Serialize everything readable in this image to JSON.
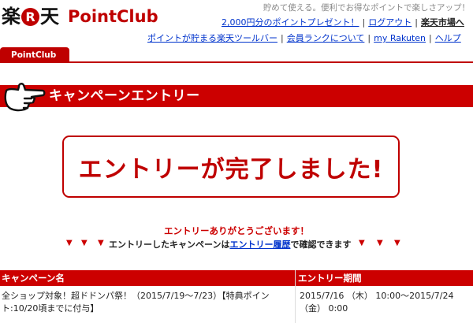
{
  "header": {
    "logo_raku": "楽",
    "logo_r": "R",
    "logo_ten": "天",
    "logo_pointclub": "PointClub",
    "tagline": "貯めて使える。便利でお得なポイントで楽しさアップ！",
    "links_row1": [
      "2,000円分のポイントプレゼント！",
      "ログアウト",
      "楽天市場へ"
    ],
    "links_row2": [
      "ポイントが貯まる楽天ツールバー",
      "会員ランクについて",
      "my Rakuten",
      "ヘルプ"
    ]
  },
  "tab": {
    "label": "PointClub"
  },
  "banner": {
    "title": "キャンペーンエントリー",
    "icon": "pointing-hand-icon"
  },
  "complete": {
    "message": "エントリーが完了しました!"
  },
  "thanks": {
    "message": "エントリーありがとうございます！",
    "confirm_before": "エントリーしたキャンペーンは",
    "confirm_link": "エントリー履歴",
    "confirm_after": "で確認できます",
    "marker": "▼"
  },
  "table": {
    "headers": [
      "キャンペーン名",
      "エントリー期間"
    ],
    "rows": [
      {
        "campaign": "全ショップ対象！超ドドンパ祭！（2015/7/19〜7/23）【特典ポイント:10/20頃までに付与】",
        "period": "2015/7/16 （木） 10:00〜2015/7/24 （金） 0:00"
      }
    ]
  },
  "colors": {
    "brand_red": "#bf0000",
    "banner_red": "#cc0000",
    "link_blue": "#0033cc"
  }
}
